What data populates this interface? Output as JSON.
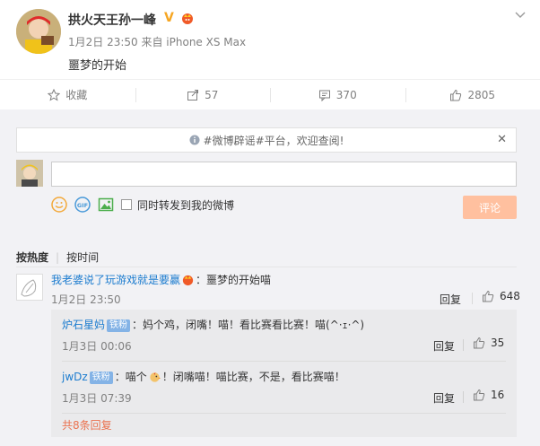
{
  "post": {
    "author": "拱火天王孙一峰",
    "verified": "V",
    "meta": "1月2日 23:50 来自 iPhone XS Max",
    "text": "噩梦的开始"
  },
  "actions": {
    "favorite": "收藏",
    "repost": "57",
    "comment": "370",
    "like": "2805"
  },
  "composer": {
    "rumor_notice": "#微博辟谣#平台，欢迎查阅!",
    "repost_checkbox": "同时转发到我的微博",
    "submit": "评论"
  },
  "sort": {
    "by_hot": "按热度",
    "by_time": "按时间"
  },
  "comment": {
    "user": "我老婆说了玩游戏就是要赢",
    "text": "：噩梦的开始喵",
    "time": "1月2日 23:50",
    "reply": "回复",
    "likes": "648"
  },
  "replies": [
    {
      "user": "炉石星妈",
      "badge": "铁粉",
      "text": "：妈个鸡，闭嘴！喵！看比赛看比赛！喵(^·ｪ·^)",
      "time": "1月3日 00:06",
      "reply": "回复",
      "likes": "35"
    },
    {
      "user": "jwDz",
      "badge": "铁粉",
      "text_a": "：喵个",
      "text_b": "！闭嘴喵！喵比赛，不是，看比赛喵！",
      "time": "1月3日 07:39",
      "reply": "回复",
      "likes": "16"
    }
  ],
  "more_replies": "共8条回复"
}
